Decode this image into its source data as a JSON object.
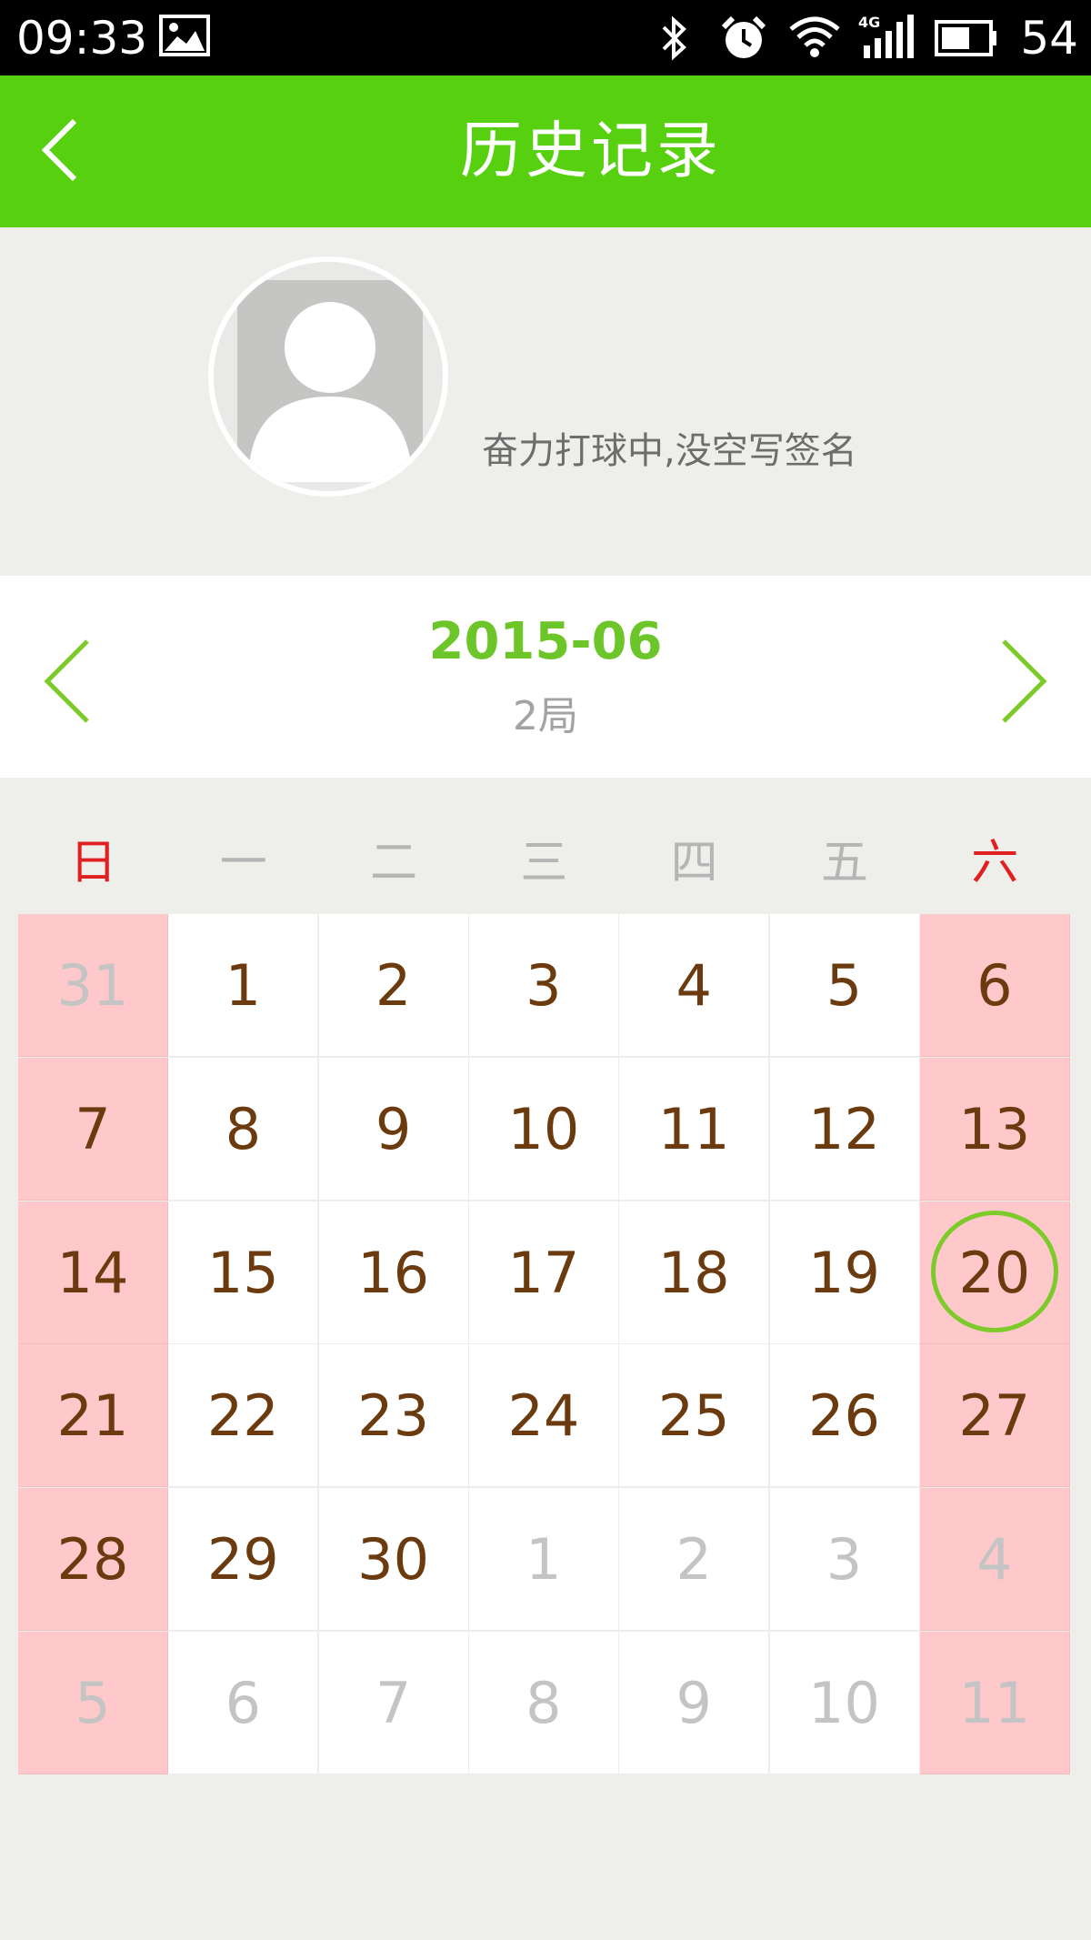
{
  "status_bar": {
    "time": "09:33",
    "battery": "54",
    "icons": [
      "image-icon",
      "bluetooth-icon",
      "alarm-icon",
      "wifi-icon",
      "signal-4g-icon",
      "battery-icon"
    ]
  },
  "header": {
    "title": "历史记录",
    "color": "#57d010"
  },
  "profile": {
    "signature": "奋力打球中,没空写签名"
  },
  "calendar": {
    "month": "2015-06",
    "games": "2局",
    "weekdays": [
      "日",
      "一",
      "二",
      "三",
      "四",
      "五",
      "六"
    ],
    "selected_day": "20",
    "weeks": [
      [
        {
          "d": "31",
          "o": true
        },
        {
          "d": "1"
        },
        {
          "d": "2"
        },
        {
          "d": "3"
        },
        {
          "d": "4"
        },
        {
          "d": "5"
        },
        {
          "d": "6"
        }
      ],
      [
        {
          "d": "7"
        },
        {
          "d": "8"
        },
        {
          "d": "9"
        },
        {
          "d": "10"
        },
        {
          "d": "11"
        },
        {
          "d": "12"
        },
        {
          "d": "13"
        }
      ],
      [
        {
          "d": "14"
        },
        {
          "d": "15"
        },
        {
          "d": "16"
        },
        {
          "d": "17"
        },
        {
          "d": "18"
        },
        {
          "d": "19"
        },
        {
          "d": "20",
          "sel": true
        }
      ],
      [
        {
          "d": "21"
        },
        {
          "d": "22"
        },
        {
          "d": "23"
        },
        {
          "d": "24"
        },
        {
          "d": "25"
        },
        {
          "d": "26"
        },
        {
          "d": "27"
        }
      ],
      [
        {
          "d": "28"
        },
        {
          "d": "29"
        },
        {
          "d": "30"
        },
        {
          "d": "1",
          "o": true
        },
        {
          "d": "2",
          "o": true
        },
        {
          "d": "3",
          "o": true
        },
        {
          "d": "4",
          "o": true
        }
      ],
      [
        {
          "d": "5",
          "o": true
        },
        {
          "d": "6",
          "o": true
        },
        {
          "d": "7",
          "o": true
        },
        {
          "d": "8",
          "o": true
        },
        {
          "d": "9",
          "o": true
        },
        {
          "d": "10",
          "o": true
        },
        {
          "d": "11",
          "o": true
        }
      ]
    ],
    "colors": {
      "accent": "#6cc629",
      "weekend_bg": "#ffc9cb",
      "weekend_header": "#e02020",
      "day_text": "#6b3a0e",
      "other_month_text": "#c4c4c4"
    }
  }
}
